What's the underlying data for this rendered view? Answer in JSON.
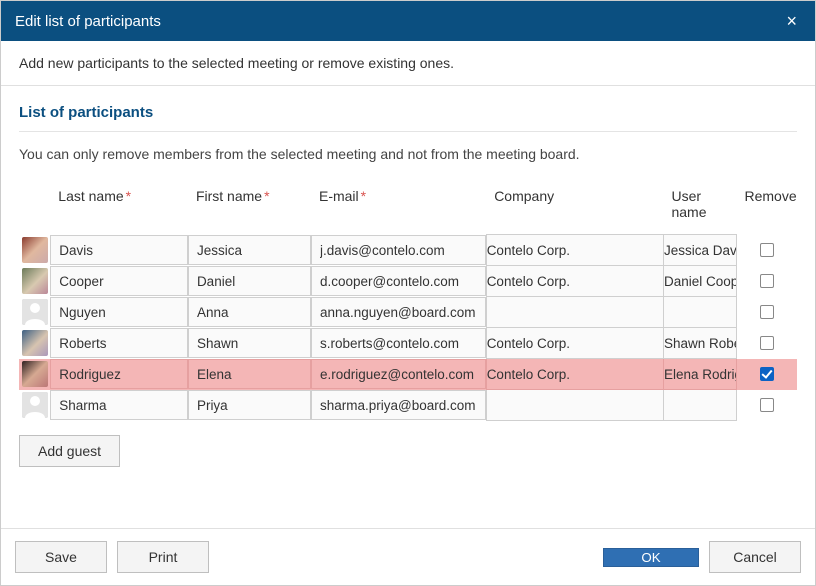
{
  "title": "Edit list of participants",
  "subtitle": "Add new participants to the selected meeting or remove existing ones.",
  "section_title": "List of participants",
  "hint": "You can only remove members from the selected meeting and not from the meeting board.",
  "columns": {
    "last": "Last name",
    "first": "First name",
    "email": "E-mail",
    "company": "Company",
    "user": "User name",
    "remove": "Remove"
  },
  "rows": [
    {
      "avatar": "photo1",
      "last": "Davis",
      "first": "Jessica",
      "email": "j.davis@contelo.com",
      "company": "Contelo Corp.",
      "user": "Jessica Davis",
      "remove": false
    },
    {
      "avatar": "photo2",
      "last": "Cooper",
      "first": "Daniel",
      "email": "d.cooper@contelo.com",
      "company": "Contelo Corp.",
      "user": "Daniel Cooper",
      "remove": false
    },
    {
      "avatar": "placeholder",
      "last": "Nguyen",
      "first": "Anna",
      "email": "anna.nguyen@board.com",
      "company": "",
      "user": "",
      "remove": false
    },
    {
      "avatar": "photo3",
      "last": "Roberts",
      "first": "Shawn",
      "email": "s.roberts@contelo.com",
      "company": "Contelo Corp.",
      "user": "Shawn Roberts",
      "remove": false
    },
    {
      "avatar": "photo4",
      "last": "Rodriguez",
      "first": "Elena",
      "email": "e.rodriguez@contelo.com",
      "company": "Contelo Corp.",
      "user": "Elena Rodriguez",
      "remove": true
    },
    {
      "avatar": "placeholder",
      "last": "Sharma",
      "first": "Priya",
      "email": "sharma.priya@board.com",
      "company": "",
      "user": "",
      "remove": false
    }
  ],
  "buttons": {
    "add_guest": "Add guest",
    "save": "Save",
    "print": "Print",
    "ok": "OK",
    "cancel": "Cancel"
  }
}
